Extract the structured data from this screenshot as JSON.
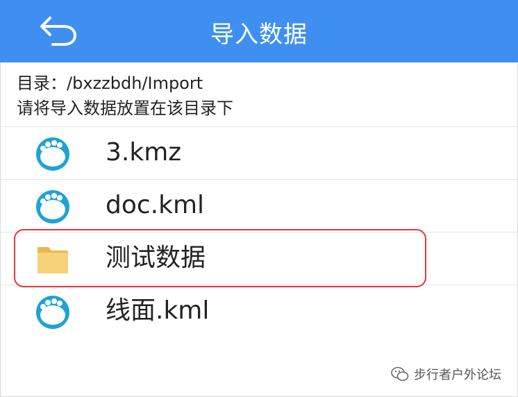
{
  "header": {
    "title": "导入数据",
    "back_icon": "back-arrow-icon",
    "background_color": "#3f8ff0"
  },
  "info": {
    "directory_label": "目录：",
    "directory_path": "/bxzzbdh/Import",
    "hint": "请将导入数据放置在该目录下"
  },
  "files": [
    {
      "name": "3.kmz",
      "icon": "map-file-icon",
      "selected": false
    },
    {
      "name": "doc.kml",
      "icon": "map-file-icon",
      "selected": false
    },
    {
      "name": "测试数据",
      "icon": "folder-icon",
      "selected": true
    },
    {
      "name": "线面.kml",
      "icon": "map-file-icon",
      "selected": false
    }
  ],
  "highlight_color": "#e0383f",
  "watermark": {
    "text": "步行者户外论坛",
    "icon": "wechat-icon"
  }
}
